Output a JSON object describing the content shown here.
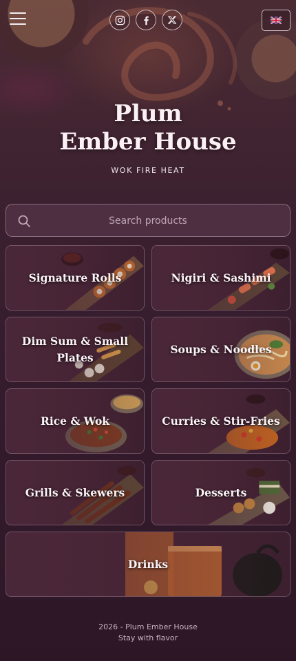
{
  "header": {
    "menu_icon": "hamburger-menu-icon",
    "socials": [
      {
        "name": "Instagram",
        "icon": "instagram-icon"
      },
      {
        "name": "Facebook",
        "icon": "facebook-icon"
      },
      {
        "name": "X",
        "icon": "x-icon"
      }
    ],
    "language": {
      "flag": "uk-flag-icon"
    }
  },
  "hero": {
    "title_line1": "Plum",
    "title_line2": "Ember House",
    "tagline": "WOK FIRE HEAT"
  },
  "search": {
    "placeholder": "Search products"
  },
  "categories": [
    {
      "label": "Signature Rolls"
    },
    {
      "label": "Nigiri & Sashimi"
    },
    {
      "label": "Dim Sum & Small Plates"
    },
    {
      "label": "Soups & Noodles"
    },
    {
      "label": "Rice & Wok"
    },
    {
      "label": "Curries & Stir-Fries"
    },
    {
      "label": "Grills & Skewers"
    },
    {
      "label": "Desserts"
    },
    {
      "label": "Drinks"
    }
  ],
  "footer": {
    "copyright": "2026 - Plum Ember House",
    "slogan": "Stay with flavor"
  },
  "colors": {
    "background": "#341b2c",
    "card": "#4a2738",
    "accent": "#c87a4a",
    "text": "#f3e8ee"
  }
}
